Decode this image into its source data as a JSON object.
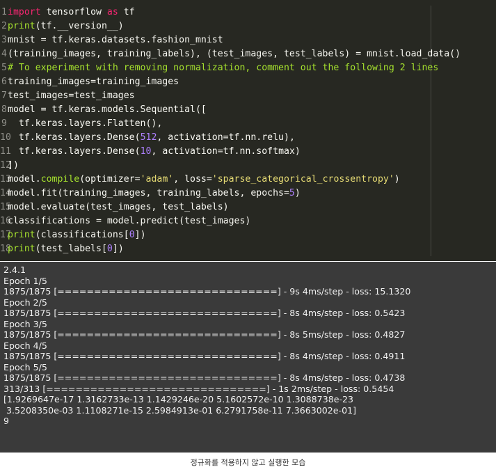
{
  "editor": {
    "lines": [
      {
        "n": "1",
        "html": "<span class=\"kw\">import</span> tensorflow <span class=\"kw\">as</span> tf"
      },
      {
        "n": "2",
        "html": "<span class=\"fn\">print</span>(tf.__version__)"
      },
      {
        "n": "3",
        "html": "mnist = tf.keras.datasets.fashion_mnist"
      },
      {
        "n": "4",
        "html": "(training_images, training_labels), (test_images, test_labels) = mnist.load_data()"
      },
      {
        "n": "5",
        "html": "<span class=\"cm\"># To experiment with removing normalization, comment out the following 2 lines</span>"
      },
      {
        "n": "6",
        "html": "training_images=training_images"
      },
      {
        "n": "7",
        "html": "test_images=test_images"
      },
      {
        "n": "8",
        "html": "model = tf.keras.models.Sequential(["
      },
      {
        "n": "9",
        "html": "  tf.keras.layers.Flatten(),"
      },
      {
        "n": "10",
        "html": "  tf.keras.layers.Dense(<span class=\"num\">512</span>, activation=tf.nn.relu),"
      },
      {
        "n": "11",
        "html": "  tf.keras.layers.Dense(<span class=\"num\">10</span>, activation=tf.nn.softmax)"
      },
      {
        "n": "12",
        "html": "])"
      },
      {
        "n": "13",
        "html": "model.<span class=\"fn\">compile</span>(optimizer=<span class=\"str\">'adam'</span>, loss=<span class=\"str\">'sparse_categorical_crossentropy'</span>)"
      },
      {
        "n": "14",
        "html": "model.fit(training_images, training_labels, epochs=<span class=\"num\">5</span>)"
      },
      {
        "n": "15",
        "html": "model.evaluate(test_images, test_labels)"
      },
      {
        "n": "16",
        "html": "classifications = model.predict(test_images)"
      },
      {
        "n": "17",
        "html": "<span class=\"fn\">print</span>(classifications[<span class=\"num\">0</span>])"
      },
      {
        "n": "18",
        "html": "<span class=\"fn\">print</span>(test_labels[<span class=\"num\">0</span>])"
      }
    ]
  },
  "output": {
    "lines": [
      "2.4.1",
      "Epoch 1/5",
      "1875/1875 [==============================] - 9s 4ms/step - loss: 15.1320",
      "Epoch 2/5",
      "1875/1875 [==============================] - 8s 4ms/step - loss: 0.5423",
      "Epoch 3/5",
      "1875/1875 [==============================] - 8s 5ms/step - loss: 0.4827",
      "Epoch 4/5",
      "1875/1875 [==============================] - 8s 4ms/step - loss: 0.4911",
      "Epoch 5/5",
      "1875/1875 [==============================] - 8s 4ms/step - loss: 0.4738",
      "313/313 [==============================] - 1s 2ms/step - loss: 0.5454",
      "[1.9269647e-17 1.3162733e-13 1.1429246e-20 5.1602572e-10 1.3088738e-23",
      " 3.5208350e-03 1.1108271e-15 2.5984913e-01 6.2791758e-11 7.3663002e-01]",
      "9"
    ]
  },
  "caption": "정규화를 적용하지 않고 실행한 모습"
}
